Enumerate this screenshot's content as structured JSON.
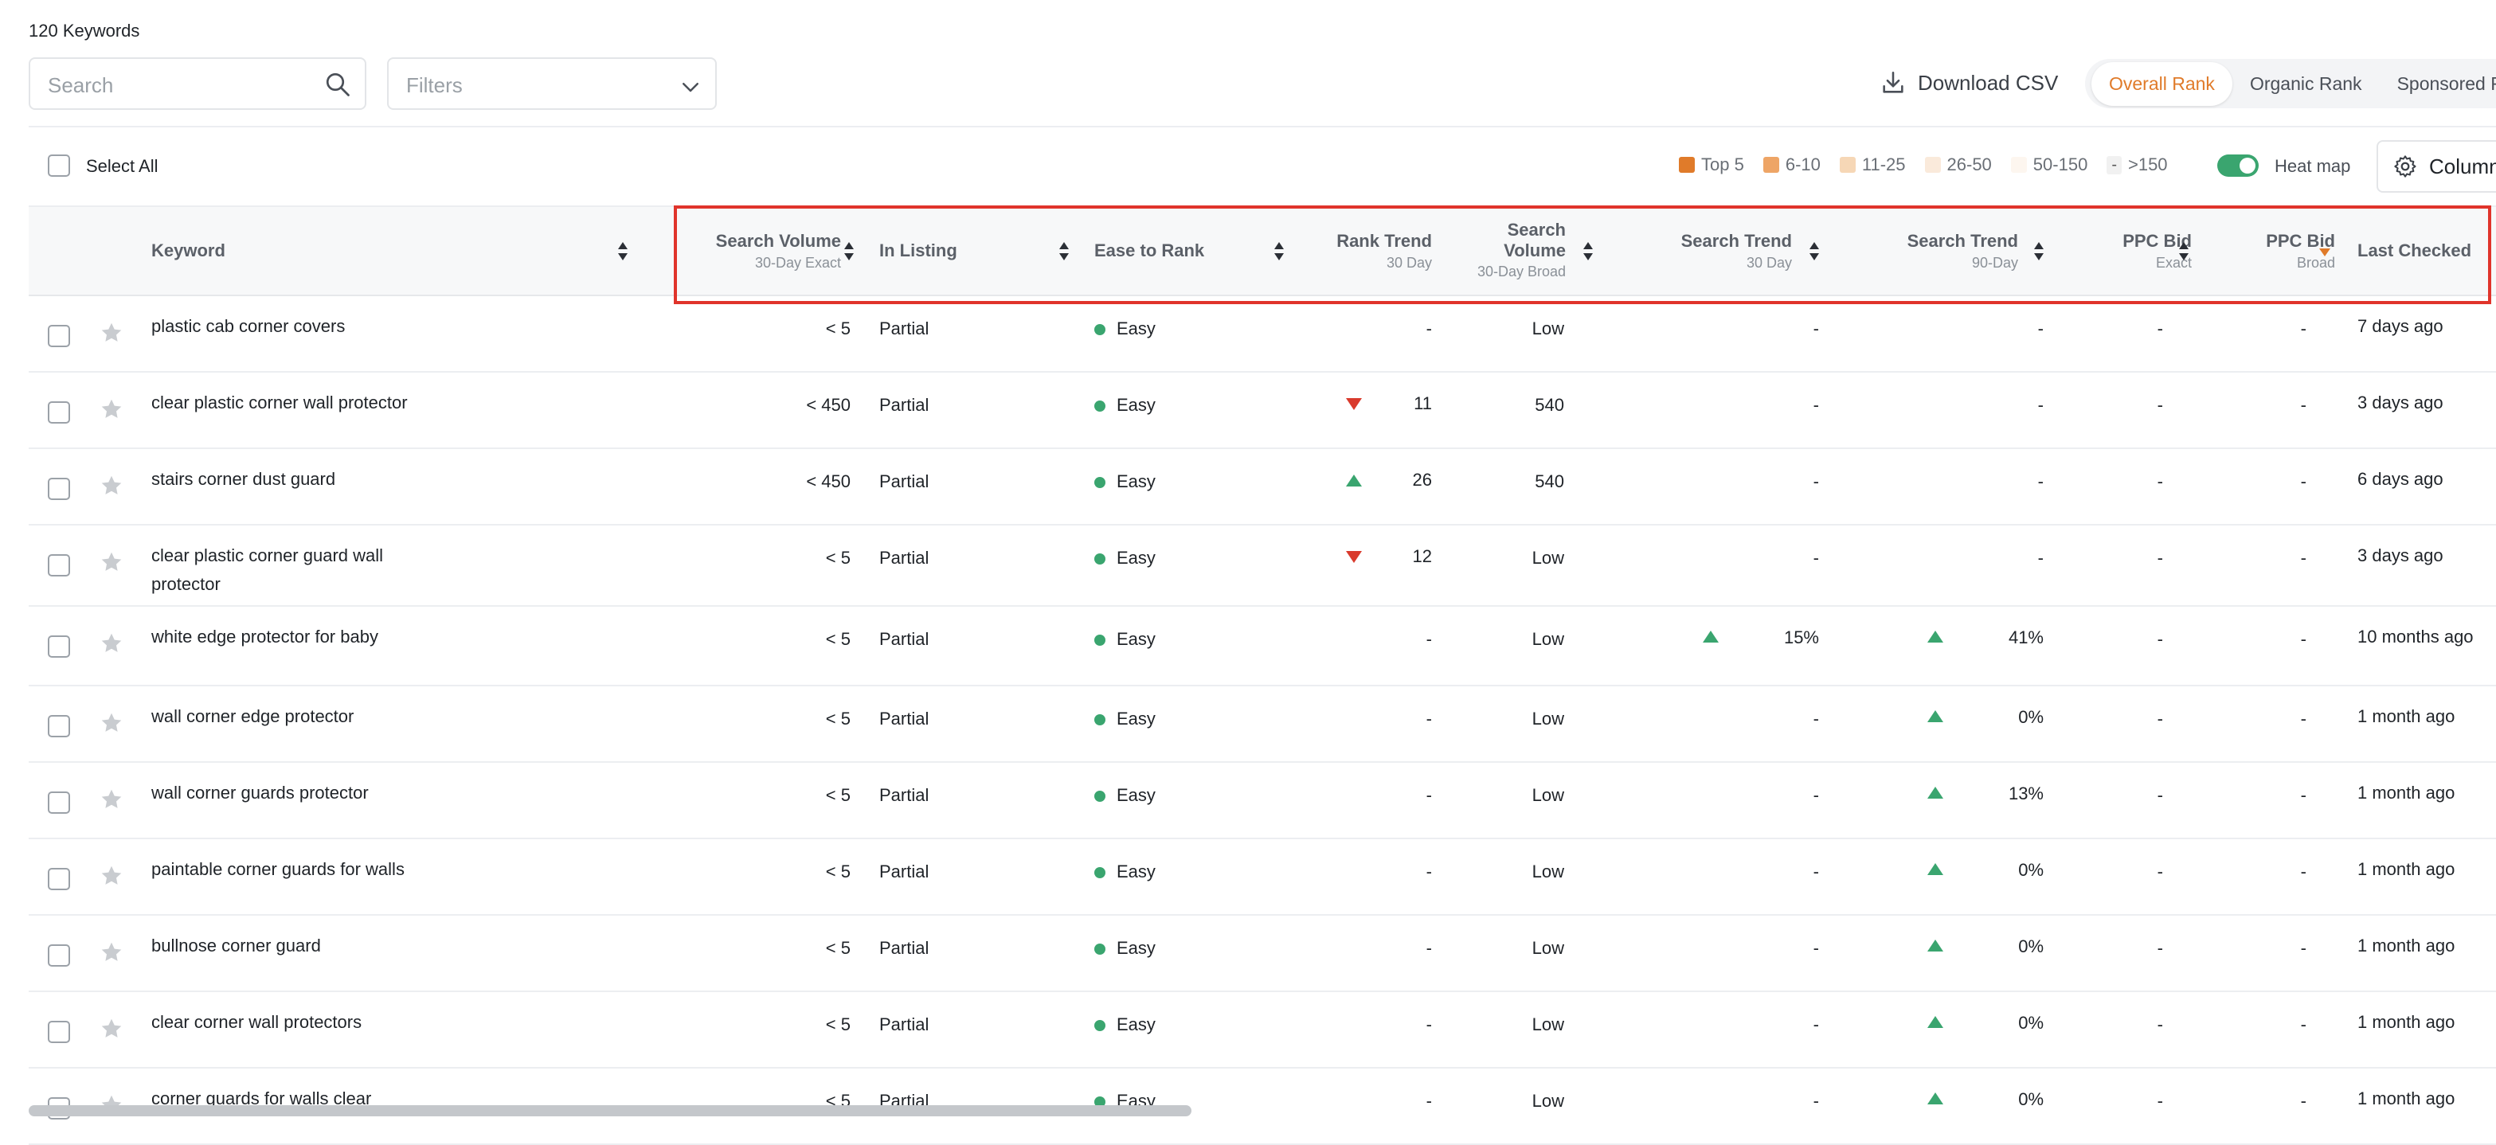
{
  "header": {
    "keyword_count": "120 Keywords",
    "search_placeholder": "Search",
    "filters_placeholder": "Filters",
    "download_label": "Download CSV",
    "rank_tabs": [
      {
        "label": "Overall Rank",
        "active": true
      },
      {
        "label": "Organic Rank",
        "active": false
      },
      {
        "label": "Sponsored R",
        "active": false
      }
    ]
  },
  "toolbar": {
    "select_all_label": "Select All",
    "legend": [
      {
        "label": "Top 5",
        "color": "#e07b2a"
      },
      {
        "label": "6-10",
        "color": "#eea566"
      },
      {
        "label": "11-25",
        "color": "#f6d7b6"
      },
      {
        "label": "26-50",
        "color": "#faeadb"
      },
      {
        "label": "50-150",
        "color": "#fdf6ef"
      }
    ],
    "legend_dash": "-",
    "legend_last": ">150",
    "heatmap_label": "Heat map",
    "heatmap_on": true,
    "columns_label": "Column"
  },
  "columns": {
    "keyword": {
      "label": "Keyword"
    },
    "search_volume": {
      "label": "Search Volume",
      "sub": "30-Day Exact"
    },
    "in_listing": {
      "label": "In Listing"
    },
    "ease_to_rank": {
      "label": "Ease to Rank"
    },
    "rank_trend": {
      "label": "Rank Trend",
      "sub": "30 Day"
    },
    "search_volume_broad": {
      "label1": "Search",
      "label2": "Volume",
      "sub": "30-Day Broad"
    },
    "search_trend_30": {
      "label": "Search Trend",
      "sub": "30 Day"
    },
    "search_trend_90": {
      "label": "Search Trend",
      "sub": "90-Day"
    },
    "ppc_exact": {
      "label": "PPC Bid",
      "sub": "Exact"
    },
    "ppc_broad": {
      "label": "PPC Bid",
      "sub": "Broad"
    },
    "last_checked": {
      "label": "Last Checked"
    }
  },
  "rows": [
    {
      "keyword": "plastic cab corner covers",
      "sv": "< 5",
      "listing": "Partial",
      "ease": "Easy",
      "rank_dir": "",
      "rank": "-",
      "svb": "Low",
      "st30_dir": "",
      "st30": "-",
      "st90_dir": "",
      "st90": "-",
      "ppc_exact": "-",
      "ppc_broad": "-",
      "last_checked": "7 days ago"
    },
    {
      "keyword": "clear plastic corner wall protector",
      "sv": "< 450",
      "listing": "Partial",
      "ease": "Easy",
      "rank_dir": "down",
      "rank": "11",
      "svb": "540",
      "st30_dir": "",
      "st30": "-",
      "st90_dir": "",
      "st90": "-",
      "ppc_exact": "-",
      "ppc_broad": "-",
      "last_checked": "3 days ago"
    },
    {
      "keyword": "stairs corner dust guard",
      "sv": "< 450",
      "listing": "Partial",
      "ease": "Easy",
      "rank_dir": "up",
      "rank": "26",
      "svb": "540",
      "st30_dir": "",
      "st30": "-",
      "st90_dir": "",
      "st90": "-",
      "ppc_exact": "-",
      "ppc_broad": "-",
      "last_checked": "6 days ago"
    },
    {
      "keyword": "clear plastic corner guard wall protector",
      "sv": "< 5",
      "listing": "Partial",
      "ease": "Easy",
      "rank_dir": "down",
      "rank": "12",
      "svb": "Low",
      "st30_dir": "",
      "st30": "-",
      "st90_dir": "",
      "st90": "-",
      "ppc_exact": "-",
      "ppc_broad": "-",
      "last_checked": "3 days ago"
    },
    {
      "keyword": "white edge protector for baby",
      "sv": "< 5",
      "listing": "Partial",
      "ease": "Easy",
      "rank_dir": "",
      "rank": "-",
      "svb": "Low",
      "st30_dir": "up",
      "st30": "15%",
      "st90_dir": "up",
      "st90": "41%",
      "ppc_exact": "-",
      "ppc_broad": "-",
      "last_checked": "10 months ago"
    },
    {
      "keyword": "wall corner edge protector",
      "sv": "< 5",
      "listing": "Partial",
      "ease": "Easy",
      "rank_dir": "",
      "rank": "-",
      "svb": "Low",
      "st30_dir": "",
      "st30": "-",
      "st90_dir": "up",
      "st90": "0%",
      "ppc_exact": "-",
      "ppc_broad": "-",
      "last_checked": "1 month ago"
    },
    {
      "keyword": "wall corner guards protector",
      "sv": "< 5",
      "listing": "Partial",
      "ease": "Easy",
      "rank_dir": "",
      "rank": "-",
      "svb": "Low",
      "st30_dir": "",
      "st30": "-",
      "st90_dir": "up",
      "st90": "13%",
      "ppc_exact": "-",
      "ppc_broad": "-",
      "last_checked": "1 month ago"
    },
    {
      "keyword": "paintable corner guards for walls",
      "sv": "< 5",
      "listing": "Partial",
      "ease": "Easy",
      "rank_dir": "",
      "rank": "-",
      "svb": "Low",
      "st30_dir": "",
      "st30": "-",
      "st90_dir": "up",
      "st90": "0%",
      "ppc_exact": "-",
      "ppc_broad": "-",
      "last_checked": "1 month ago"
    },
    {
      "keyword": "bullnose corner guard",
      "sv": "< 5",
      "listing": "Partial",
      "ease": "Easy",
      "rank_dir": "",
      "rank": "-",
      "svb": "Low",
      "st30_dir": "",
      "st30": "-",
      "st90_dir": "up",
      "st90": "0%",
      "ppc_exact": "-",
      "ppc_broad": "-",
      "last_checked": "1 month ago"
    },
    {
      "keyword": "clear corner wall protectors",
      "sv": "< 5",
      "listing": "Partial",
      "ease": "Easy",
      "rank_dir": "",
      "rank": "-",
      "svb": "Low",
      "st30_dir": "",
      "st30": "-",
      "st90_dir": "up",
      "st90": "0%",
      "ppc_exact": "-",
      "ppc_broad": "-",
      "last_checked": "1 month ago"
    },
    {
      "keyword": "corner guards for walls clear",
      "sv": "< 5",
      "listing": "Partial",
      "ease": "Easy",
      "rank_dir": "",
      "rank": "-",
      "svb": "Low",
      "st30_dir": "",
      "st30": "-",
      "st90_dir": "up",
      "st90": "0%",
      "ppc_exact": "-",
      "ppc_broad": "-",
      "last_checked": "1 month ago"
    }
  ]
}
